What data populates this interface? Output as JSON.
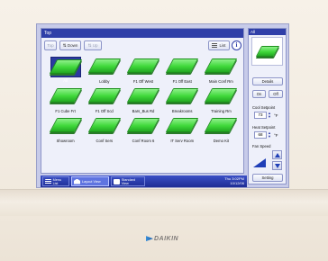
{
  "device": {
    "brand": "DAIKIN"
  },
  "main": {
    "title": "Top",
    "toolbar": {
      "top_label": "Top",
      "down_label": "Down",
      "up_label": "Up",
      "list_label": "List",
      "info": "i"
    },
    "zones": [
      {
        "label": "All",
        "selected": true
      },
      {
        "label": "Lobby"
      },
      {
        "label": "F1 Off West"
      },
      {
        "label": "F1 Off East"
      },
      {
        "label": "Main Conf Rm"
      },
      {
        "label": "F1 Cube Frt"
      },
      {
        "label": "F1 Off Scd"
      },
      {
        "label": "Bars_Bus Rd"
      },
      {
        "label": "Breakrooms"
      },
      {
        "label": "Training Rm"
      },
      {
        "label": "Showroom"
      },
      {
        "label": "Conf Sers"
      },
      {
        "label": "Conf Room 6"
      },
      {
        "label": "IT Serv Room"
      },
      {
        "label": "Demo Kit"
      }
    ]
  },
  "side": {
    "title": "All",
    "details_label": "Details",
    "on_label": "On",
    "off_label": "Off",
    "cool_setpoint_label": "Cool Setpoint",
    "cool_setpoint_value": "73",
    "heat_setpoint_label": "Heat Setpoint",
    "heat_setpoint_value": "68",
    "temp_unit": "°F",
    "fan_speed_label": "Fan Speed",
    "setting_label": "Setting"
  },
  "bottom": {
    "menu_list": "Menu List",
    "layout_view": "Layout View",
    "standard_view": "Standard View",
    "time": "Thu  3:02PM",
    "date": "10/12/06"
  },
  "colors": {
    "title_bar": "#2f3fa8",
    "unit_green": "#3fd83a",
    "screen_bg": "#c7cbe9",
    "bezel": "#f5efe6"
  }
}
